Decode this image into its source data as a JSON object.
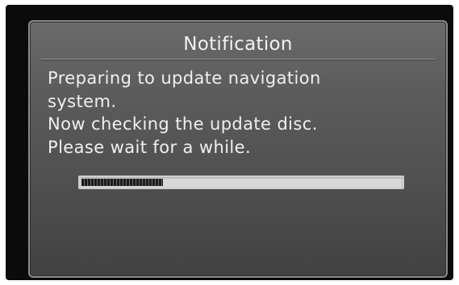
{
  "dialog": {
    "title": "Notification",
    "message_lines": [
      "Preparing to update navigation",
      "system.",
      "Now checking the update disc.",
      "Please wait for a while."
    ]
  },
  "progress": {
    "fraction": 0.255
  },
  "colors": {
    "bezel": "#0b0b0b",
    "dialog_bg": "#5b5b5b",
    "text": "#f0f0f0",
    "progress_track": "#d9d9d9",
    "progress_fill": "#1c1c1c"
  }
}
